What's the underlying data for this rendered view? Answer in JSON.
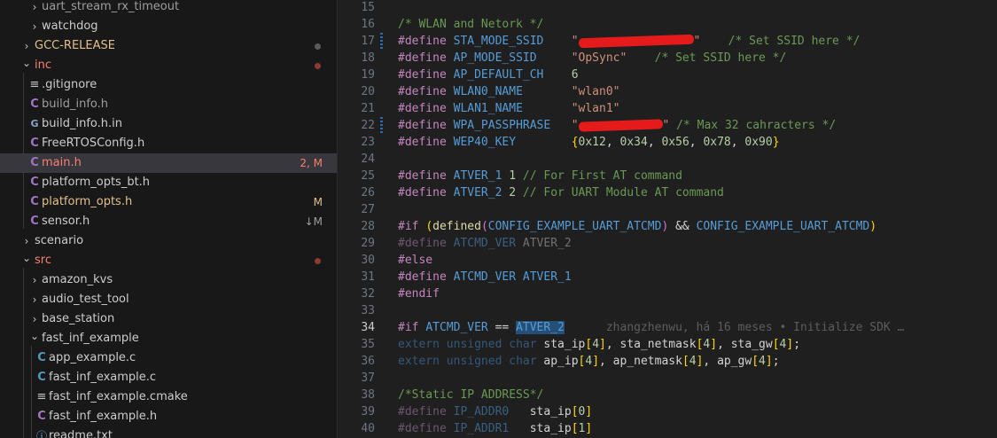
{
  "explorer": {
    "rows": [
      {
        "label": "uart_stream_rx_timeout",
        "kind": "folder",
        "state": "collapsed"
      },
      {
        "label": "watchdog",
        "kind": "folder",
        "state": "collapsed"
      },
      {
        "label": "GCC-RELEASE",
        "kind": "folder",
        "state": "collapsed",
        "status": "dot"
      },
      {
        "label": "inc",
        "kind": "folder",
        "state": "expanded",
        "status": "dot"
      },
      {
        "label": ".gitignore",
        "kind": "file",
        "icon": "lines-icon"
      },
      {
        "label": "build_info.h",
        "kind": "file",
        "icon": "c-header-icon"
      },
      {
        "label": "build_info.h.in",
        "kind": "file",
        "icon": "git-file-icon"
      },
      {
        "label": "FreeRTOSConfig.h",
        "kind": "file",
        "icon": "c-header-icon"
      },
      {
        "label": "main.h",
        "kind": "file",
        "icon": "c-header-icon",
        "status": "2, M"
      },
      {
        "label": "platform_opts_bt.h",
        "kind": "file",
        "icon": "c-header-icon"
      },
      {
        "label": "platform_opts.h",
        "kind": "file",
        "icon": "c-header-icon",
        "status": "M"
      },
      {
        "label": "sensor.h",
        "kind": "file",
        "icon": "c-header-icon",
        "status": "↓M"
      },
      {
        "label": "scenario",
        "kind": "folder",
        "state": "collapsed"
      },
      {
        "label": "src",
        "kind": "folder",
        "state": "expanded",
        "status": "dot"
      },
      {
        "label": "amazon_kvs",
        "kind": "folder",
        "state": "collapsed"
      },
      {
        "label": "audio_test_tool",
        "kind": "folder",
        "state": "collapsed"
      },
      {
        "label": "base_station",
        "kind": "folder",
        "state": "collapsed"
      },
      {
        "label": "fast_inf_example",
        "kind": "folder",
        "state": "expanded"
      },
      {
        "label": "app_example.c",
        "kind": "file",
        "icon": "c-source-icon"
      },
      {
        "label": "fast_inf_example.c",
        "kind": "file",
        "icon": "c-source-icon"
      },
      {
        "label": "fast_inf_example.cmake",
        "kind": "file",
        "icon": "lines-icon"
      },
      {
        "label": "fast_inf_example.h",
        "kind": "file",
        "icon": "c-header-icon"
      },
      {
        "label": "readme.txt",
        "kind": "file",
        "icon": "info-icon"
      }
    ]
  },
  "editor": {
    "active_line": "34",
    "lines": [
      {
        "n": "15",
        "t": []
      },
      {
        "n": "16",
        "t": [
          [
            "cmt",
            "/* WLAN and Netork */"
          ]
        ]
      },
      {
        "n": "17",
        "mod": true,
        "t": [
          [
            "kw",
            "#define"
          ],
          [
            "plain",
            " "
          ],
          [
            "macro",
            "STA_MODE_SSID"
          ],
          [
            "plain",
            "    "
          ],
          [
            "str",
            "\""
          ],
          [
            "redact",
            "130"
          ],
          [
            "str",
            "\""
          ],
          [
            "plain",
            "    "
          ],
          [
            "cmt",
            "/* Set SSID here */"
          ]
        ]
      },
      {
        "n": "18",
        "t": [
          [
            "kw",
            "#define"
          ],
          [
            "plain",
            " "
          ],
          [
            "macro",
            "AP_MODE_SSID"
          ],
          [
            "plain",
            "     "
          ],
          [
            "str",
            "\"OpSync\""
          ],
          [
            "plain",
            "    "
          ],
          [
            "cmt",
            "/* Set SSID here */"
          ]
        ]
      },
      {
        "n": "19",
        "t": [
          [
            "kw",
            "#define"
          ],
          [
            "plain",
            " "
          ],
          [
            "macro",
            "AP_DEFAULT_CH"
          ],
          [
            "plain",
            "    "
          ],
          [
            "num",
            "6"
          ]
        ]
      },
      {
        "n": "20",
        "t": [
          [
            "kw",
            "#define"
          ],
          [
            "plain",
            " "
          ],
          [
            "macro",
            "WLAN0_NAME"
          ],
          [
            "plain",
            "       "
          ],
          [
            "str",
            "\"wlan0\""
          ]
        ]
      },
      {
        "n": "21",
        "t": [
          [
            "kw",
            "#define"
          ],
          [
            "plain",
            " "
          ],
          [
            "macro",
            "WLAN1_NAME"
          ],
          [
            "plain",
            "       "
          ],
          [
            "str",
            "\"wlan1\""
          ]
        ]
      },
      {
        "n": "22",
        "mod": true,
        "t": [
          [
            "kw",
            "#define"
          ],
          [
            "plain",
            " "
          ],
          [
            "macro",
            "WPA_PASSPHRASE"
          ],
          [
            "plain",
            "   "
          ],
          [
            "str",
            "\""
          ],
          [
            "redact",
            "95"
          ],
          [
            "str",
            "\""
          ],
          [
            "plain",
            " "
          ],
          [
            "cmt",
            "/* Max 32 cahracters */"
          ]
        ]
      },
      {
        "n": "23",
        "t": [
          [
            "kw",
            "#define"
          ],
          [
            "plain",
            " "
          ],
          [
            "macro",
            "WEP40_KEY"
          ],
          [
            "plain",
            "        "
          ],
          [
            "brace",
            "{"
          ],
          [
            "num",
            "0x12"
          ],
          [
            "plain",
            ", "
          ],
          [
            "num",
            "0x34"
          ],
          [
            "plain",
            ", "
          ],
          [
            "num",
            "0x56"
          ],
          [
            "plain",
            ", "
          ],
          [
            "num",
            "0x78"
          ],
          [
            "plain",
            ", "
          ],
          [
            "num",
            "0x90"
          ],
          [
            "brace",
            "}"
          ]
        ]
      },
      {
        "n": "24",
        "t": []
      },
      {
        "n": "25",
        "t": [
          [
            "kw",
            "#define"
          ],
          [
            "plain",
            " "
          ],
          [
            "macro",
            "ATVER_1"
          ],
          [
            "plain",
            " "
          ],
          [
            "num",
            "1"
          ],
          [
            "plain",
            " "
          ],
          [
            "cmt",
            "// For First AT command"
          ]
        ]
      },
      {
        "n": "26",
        "t": [
          [
            "kw",
            "#define"
          ],
          [
            "plain",
            " "
          ],
          [
            "macro",
            "ATVER_2"
          ],
          [
            "plain",
            " "
          ],
          [
            "num",
            "2"
          ],
          [
            "plain",
            " "
          ],
          [
            "cmt",
            "// For UART Module AT command"
          ]
        ]
      },
      {
        "n": "27",
        "t": []
      },
      {
        "n": "28",
        "t": [
          [
            "kw",
            "#if"
          ],
          [
            "plain",
            " "
          ],
          [
            "brace",
            "("
          ],
          [
            "fn",
            "defined"
          ],
          [
            "brace2",
            "("
          ],
          [
            "macro",
            "CONFIG_EXAMPLE_UART_ATCMD"
          ],
          [
            "brace2",
            ")"
          ],
          [
            "plain",
            " && "
          ],
          [
            "macro",
            "CONFIG_EXAMPLE_UART_ATCMD"
          ],
          [
            "brace",
            ")"
          ]
        ]
      },
      {
        "n": "29",
        "t": [
          [
            "kwdim",
            "#define"
          ],
          [
            "plain",
            " "
          ],
          [
            "macrodim",
            "ATCMD_VER"
          ],
          [
            "plain",
            " "
          ],
          [
            "dim",
            "ATVER_2"
          ]
        ]
      },
      {
        "n": "30",
        "t": [
          [
            "kw",
            "#else"
          ]
        ]
      },
      {
        "n": "31",
        "t": [
          [
            "kw",
            "#define"
          ],
          [
            "plain",
            " "
          ],
          [
            "macro",
            "ATCMD_VER"
          ],
          [
            "plain",
            " "
          ],
          [
            "macro",
            "ATVER_1"
          ]
        ]
      },
      {
        "n": "32",
        "t": [
          [
            "kw",
            "#endif"
          ]
        ]
      },
      {
        "n": "33",
        "t": []
      },
      {
        "n": "34",
        "t": [
          [
            "kw",
            "#if"
          ],
          [
            "plain",
            " "
          ],
          [
            "macro",
            "ATCMD_VER"
          ],
          [
            "plain",
            " == "
          ],
          [
            "macrosel",
            "ATVER_2"
          ],
          [
            "plain",
            "      "
          ],
          [
            "blame",
            "zhangzhenwu, há 16 meses • Initialize SDK …"
          ]
        ]
      },
      {
        "n": "35",
        "t": [
          [
            "typedim",
            "extern"
          ],
          [
            "plain",
            " "
          ],
          [
            "typedim",
            "unsigned"
          ],
          [
            "plain",
            " "
          ],
          [
            "typedim",
            "char"
          ],
          [
            "plain",
            " "
          ],
          [
            "plain",
            "sta_ip"
          ],
          [
            "brace",
            "["
          ],
          [
            "num",
            "4"
          ],
          [
            "brace",
            "]"
          ],
          [
            "plain",
            ", sta_netmask"
          ],
          [
            "brace",
            "["
          ],
          [
            "num",
            "4"
          ],
          [
            "brace",
            "]"
          ],
          [
            "plain",
            ", sta_gw"
          ],
          [
            "brace",
            "["
          ],
          [
            "num",
            "4"
          ],
          [
            "brace",
            "]"
          ],
          [
            "plain",
            ";"
          ]
        ]
      },
      {
        "n": "36",
        "t": [
          [
            "typedim",
            "extern"
          ],
          [
            "plain",
            " "
          ],
          [
            "typedim",
            "unsigned"
          ],
          [
            "plain",
            " "
          ],
          [
            "typedim",
            "char"
          ],
          [
            "plain",
            " "
          ],
          [
            "plain",
            "ap_ip"
          ],
          [
            "brace",
            "["
          ],
          [
            "num",
            "4"
          ],
          [
            "brace",
            "]"
          ],
          [
            "plain",
            ", ap_netmask"
          ],
          [
            "brace",
            "["
          ],
          [
            "num",
            "4"
          ],
          [
            "brace",
            "]"
          ],
          [
            "plain",
            ", ap_gw"
          ],
          [
            "brace",
            "["
          ],
          [
            "num",
            "4"
          ],
          [
            "brace",
            "]"
          ],
          [
            "plain",
            ";"
          ]
        ]
      },
      {
        "n": "37",
        "t": []
      },
      {
        "n": "38",
        "t": [
          [
            "cmt",
            "/*Static IP ADDRESS*/"
          ]
        ]
      },
      {
        "n": "39",
        "t": [
          [
            "kwdim",
            "#define"
          ],
          [
            "plain",
            " "
          ],
          [
            "macrodim",
            "IP_ADDR0"
          ],
          [
            "plain",
            "   "
          ],
          [
            "plain",
            "sta_ip"
          ],
          [
            "brace",
            "["
          ],
          [
            "num",
            "0"
          ],
          [
            "brace",
            "]"
          ]
        ]
      },
      {
        "n": "40",
        "t": [
          [
            "kwdim",
            "#define"
          ],
          [
            "plain",
            " "
          ],
          [
            "macrodim",
            "IP_ADDR1"
          ],
          [
            "plain",
            "   "
          ],
          [
            "plain",
            "sta_ip"
          ],
          [
            "brace",
            "["
          ],
          [
            "num",
            "1"
          ],
          [
            "brace",
            "]"
          ]
        ]
      }
    ]
  },
  "colors": {
    "modified": "#e2c08d",
    "error": "#f88070",
    "selection": "#37373d",
    "background": "#1f1f1f"
  }
}
